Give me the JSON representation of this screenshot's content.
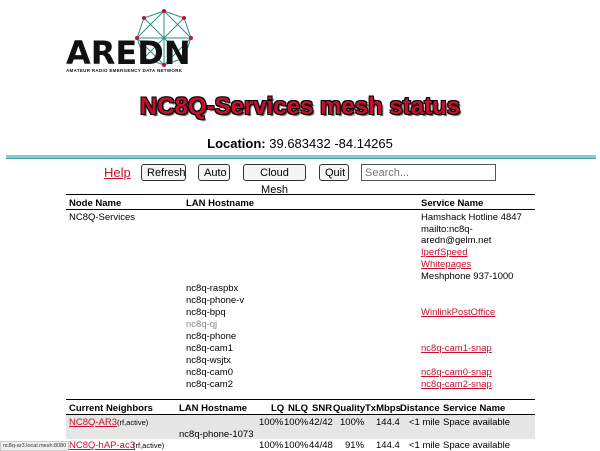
{
  "logo": {
    "name": "AREDN",
    "tagline": "AMATEUR RADIO EMERGENCY DATA NETWORK"
  },
  "page_title": "NC8Q-Services mesh status",
  "location": {
    "label": "Location:",
    "value": "39.683432 -84.14265"
  },
  "toolbar": {
    "help": "Help",
    "refresh": "Refresh",
    "auto": "Auto",
    "cloud_mesh": "Cloud Mesh",
    "quit": "Quit",
    "search_placeholder": "Search..."
  },
  "services_table": {
    "headers": {
      "node": "Node Name",
      "lan": "LAN Hostname",
      "service": "Service Name"
    },
    "node_name": "NC8Q-Services",
    "node_services": [
      {
        "text": "Hamshack Hotline 4847",
        "link": false
      },
      {
        "text": "mailto:nc8q-",
        "link": false
      },
      {
        "text": "aredn@gelm.net",
        "link": false
      },
      {
        "text": "IperfSpeed",
        "link": true
      },
      {
        "text": "Whitepages",
        "link": true
      },
      {
        "text": "Meshphone 937-1000",
        "link": false
      }
    ],
    "hosts": [
      {
        "name": "nc8q-raspbx",
        "service": "",
        "grey": false
      },
      {
        "name": "nc8q-phone-v",
        "service": "",
        "grey": false
      },
      {
        "name": "nc8q-bpq",
        "service": "WinlinkPostOffice",
        "grey": false
      },
      {
        "name": "nc8q-qj",
        "service": "",
        "grey": true
      },
      {
        "name": "nc8q-phone",
        "service": "",
        "grey": false
      },
      {
        "name": "nc8q-cam1",
        "service": "nc8q-cam1-snap",
        "grey": false
      },
      {
        "name": "nc8q-wsjtx",
        "service": "",
        "grey": false
      },
      {
        "name": "nc8q-cam0",
        "service": "nc8q-cam0-snap",
        "grey": false
      },
      {
        "name": "nc8q-cam2",
        "service": "nc8q-cam2-snap",
        "grey": false
      }
    ]
  },
  "neighbors_table": {
    "headers": {
      "neighbors": "Current Neighbors",
      "lan": "LAN Hostname",
      "lq": "LQ",
      "nlq": "NLQ",
      "snr": "SNR",
      "quality": "Quality",
      "txmbps": "TxMbps",
      "distance": "Distance",
      "service": "Service Name"
    },
    "rows": [
      {
        "name": "NC8Q-AR3",
        "tag": "(rf,active)",
        "lan": "nc8q-phone-1073",
        "lq": "100%",
        "nlq": "100%",
        "snr": "42/42",
        "quality": "100%",
        "txmbps": "144.4",
        "distance": "<1 mile",
        "service": "Space available"
      },
      {
        "name": "NC8Q-hAP-ac3",
        "tag": "(rf,active)",
        "lan": "",
        "lq": "100%",
        "nlq": "100%",
        "snr": "44/48",
        "quality": "91%",
        "txmbps": "144.4",
        "distance": "<1 mile",
        "service": "Space available"
      }
    ]
  },
  "status_bar": "nc8q-ar3.local.mesh:8080",
  "colors": {
    "accent": "#c8102e",
    "rule": "#7ecfd3"
  }
}
